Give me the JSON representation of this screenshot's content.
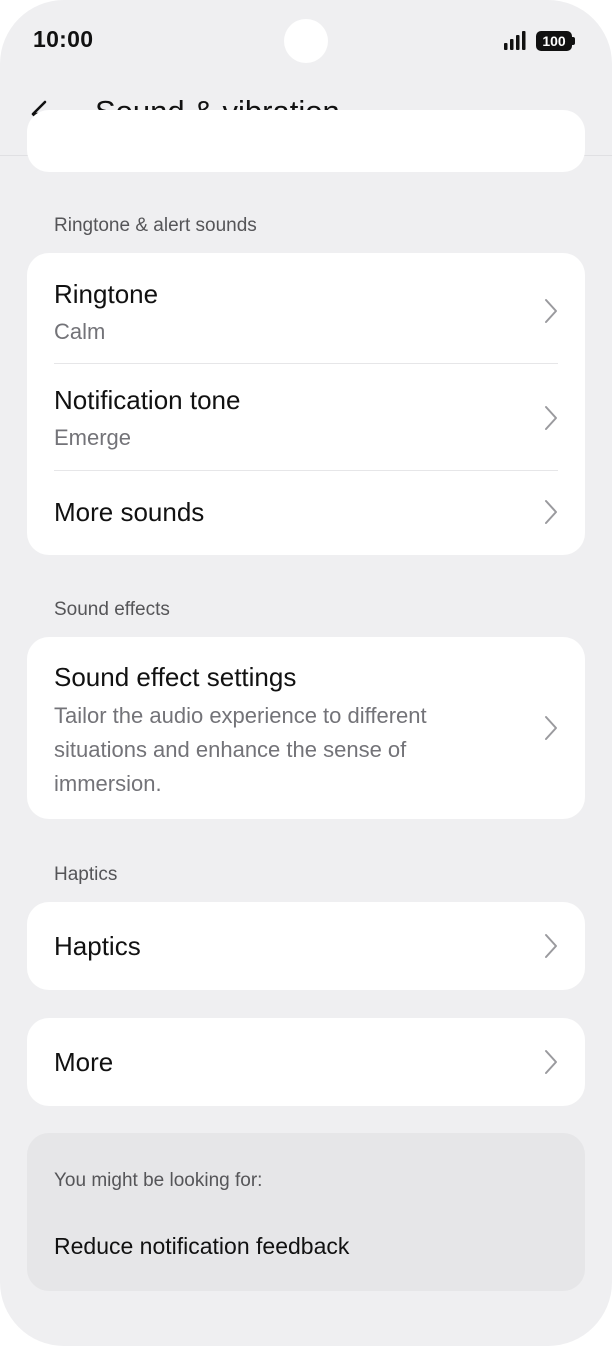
{
  "status_bar": {
    "time": "10:00",
    "battery": "100"
  },
  "header": {
    "title": "Sound & vibration",
    "back_icon": "back-arrow-icon"
  },
  "sections": {
    "ringtone": {
      "label": "Ringtone & alert sounds",
      "items": [
        {
          "title": "Ringtone",
          "subtitle": "Calm"
        },
        {
          "title": "Notification tone",
          "subtitle": "Emerge"
        },
        {
          "title": "More sounds"
        }
      ]
    },
    "sound_effects": {
      "label": "Sound effects",
      "items": [
        {
          "title": "Sound effect settings",
          "subtitle": "Tailor the audio experience to different situations and enhance the sense of immersion."
        }
      ]
    },
    "haptics": {
      "label": "Haptics",
      "items": [
        {
          "title": "Haptics"
        }
      ]
    },
    "more": {
      "items": [
        {
          "title": "More"
        }
      ]
    }
  },
  "suggestions": {
    "label": "You might be looking for:",
    "link": "Reduce notification feedback"
  },
  "icons": {
    "chevron": "chevron-right-icon",
    "signal": "signal-icon",
    "battery": "battery-icon"
  }
}
